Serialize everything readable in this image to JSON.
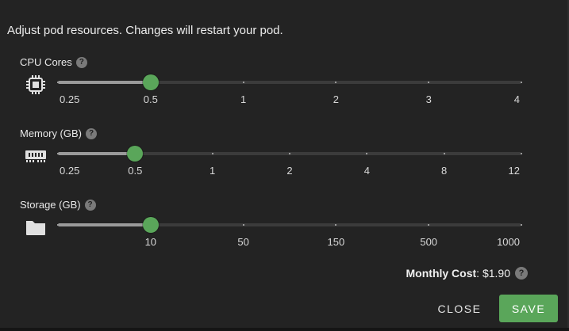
{
  "intro_text": "Adjust pod resources. Changes will restart your pod.",
  "help_glyph": "?",
  "sliders": [
    {
      "key": "cpu",
      "label": "CPU Cores",
      "icon": "cpu-chip-icon",
      "marks": [
        "0.25",
        "0.5",
        "1",
        "2",
        "3",
        "4"
      ],
      "selected": "0.5"
    },
    {
      "key": "memory",
      "label": "Memory (GB)",
      "icon": "memory-ram-icon",
      "marks": [
        "0.25",
        "0.5",
        "1",
        "2",
        "4",
        "8",
        "12"
      ],
      "selected": "0.5"
    },
    {
      "key": "storage",
      "label": "Storage (GB)",
      "icon": "folder-icon",
      "marks": [
        "",
        "10",
        "50",
        "150",
        "500",
        "1000"
      ],
      "selected": "10"
    }
  ],
  "cost": {
    "label": "Monthly Cost",
    "value": "$1.90"
  },
  "buttons": {
    "close": "CLOSE",
    "save": "SAVE"
  },
  "colors": {
    "accent": "#5aa65a",
    "background": "#232323"
  }
}
